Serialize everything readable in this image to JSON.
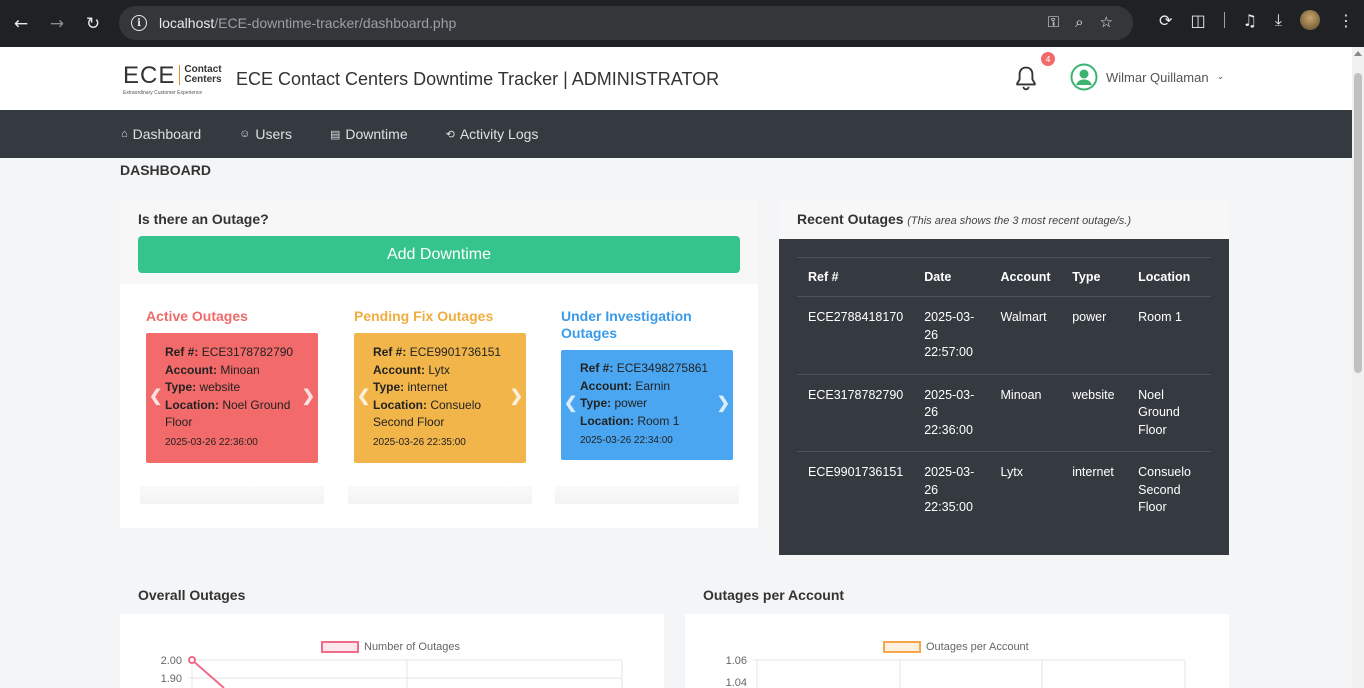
{
  "browser": {
    "url_host": "localhost",
    "url_path": "/ECE-downtime-tracker/dashboard.php"
  },
  "header": {
    "logo_main": "ECE",
    "logo_line1": "Contact",
    "logo_line2": "Centers",
    "logo_tagline": "Extraordinary Customer Experience",
    "title": "ECE Contact Centers Downtime Tracker | ADMINISTRATOR",
    "notification_count": "4",
    "user_name": "Wilmar Quillaman"
  },
  "nav": {
    "items": [
      {
        "label": "Dashboard",
        "icon": "home-icon"
      },
      {
        "label": "Users",
        "icon": "user-icon"
      },
      {
        "label": "Downtime",
        "icon": "document-icon"
      },
      {
        "label": "Activity Logs",
        "icon": "history-icon"
      }
    ]
  },
  "page": {
    "title": "DASHBOARD"
  },
  "outage_card": {
    "question": "Is there an Outage?",
    "add_button": "Add Downtime",
    "columns": [
      {
        "title": "Active Outages",
        "color": "#f36a6a",
        "title_color": "#f06a6a",
        "ref_label": "Ref #:",
        "ref": "ECE3178782790",
        "account_label": "Account:",
        "account": "Minoan",
        "type_label": "Type:",
        "type": "website",
        "location_label": "Location:",
        "location": "Noel Ground Floor",
        "timestamp": "2025-03-26 22:36:00"
      },
      {
        "title": "Pending Fix Outages",
        "color": "#f2b54a",
        "title_color": "#f0ad3e",
        "ref_label": "Ref #:",
        "ref": "ECE9901736151",
        "account_label": "Account:",
        "account": "Lytx",
        "type_label": "Type:",
        "type": "internet",
        "location_label": "Location:",
        "location": "Consuelo Second Floor",
        "timestamp": "2025-03-26 22:35:00"
      },
      {
        "title": "Under Investigation Outages",
        "color": "#4aa6f1",
        "title_color": "#3a9be8",
        "ref_label": "Ref #:",
        "ref": "ECE3498275861",
        "account_label": "Account:",
        "account": "Earnin",
        "type_label": "Type:",
        "type": "power",
        "location_label": "Location:",
        "location": "Room 1",
        "timestamp": "2025-03-26 22:34:00"
      }
    ]
  },
  "recent": {
    "title": "Recent Outages",
    "subtitle": "(This area shows the 3 most recent outage/s.)",
    "headers": [
      "Ref #",
      "Date",
      "Account",
      "Type",
      "Location"
    ],
    "rows": [
      {
        "ref": "ECE2788418170",
        "date1": "2025-03-",
        "date2": "26",
        "date3": "22:57:00",
        "account": "Walmart",
        "type": "power",
        "loc1": "Room 1",
        "loc2": "",
        "loc3": ""
      },
      {
        "ref": "ECE3178782790",
        "date1": "2025-03-",
        "date2": "26",
        "date3": "22:36:00",
        "account": "Minoan",
        "type": "website",
        "loc1": "Noel",
        "loc2": "Ground",
        "loc3": "Floor"
      },
      {
        "ref": "ECE9901736151",
        "date1": "2025-03-",
        "date2": "26",
        "date3": "22:35:00",
        "account": "Lytx",
        "type": "internet",
        "loc1": "Consuelo",
        "loc2": "Second",
        "loc3": "Floor"
      }
    ]
  },
  "charts": {
    "overall_title": "Overall Outages",
    "account_title": "Outages per Account"
  },
  "chart_data": [
    {
      "type": "line",
      "title": "",
      "series": [
        {
          "name": "Number of Outages",
          "color": "#f06b8a"
        }
      ],
      "yticks": [
        "2.00",
        "1.90"
      ]
    },
    {
      "type": "bar",
      "title": "",
      "series": [
        {
          "name": "Outages per Account",
          "color": "#f5a54a"
        }
      ],
      "yticks": [
        "1.06",
        "1.04"
      ]
    }
  ]
}
